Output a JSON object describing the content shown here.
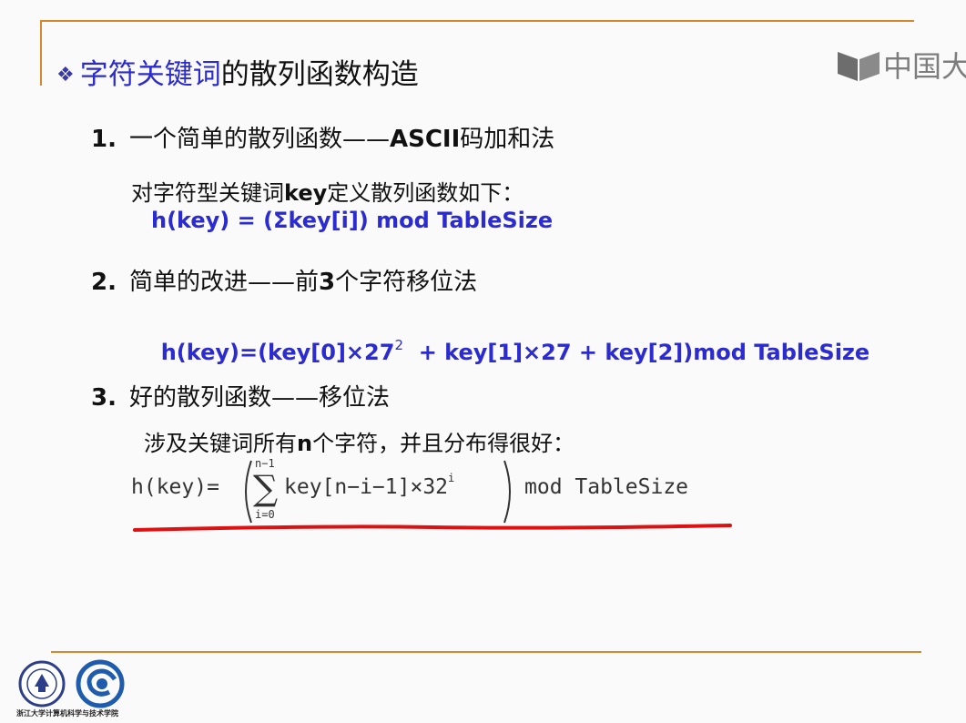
{
  "slide": {
    "title_prefix": "❖",
    "title_keyword": "字符关键词",
    "title_rest": "的散列函数构造",
    "watermark": "中国大"
  },
  "section1": {
    "number": "1.",
    "heading_cn": "一个简单的散列函数——",
    "heading_bold": "ASCII",
    "heading_tail": "码加和法",
    "desc_a": "对字符型关键词",
    "desc_key": "key",
    "desc_b": "定义散列函数如下：",
    "formula": "h(key) = (Σkey[i]) mod TableSize"
  },
  "section2": {
    "number": "2.",
    "heading_a": "简单的改进——前",
    "heading_bold": "3",
    "heading_b": "个字符移位法",
    "formula_a": "h(key)=(key[0]×27",
    "formula_sup": "2",
    "formula_b": "  + key[1]×27 + key[2])mod TableSize"
  },
  "section3": {
    "number": "3.",
    "heading": "好的散列函数——移位法",
    "desc_a": "涉及关键词所有",
    "desc_n": "n",
    "desc_b": "个字符，并且分布得很好：",
    "formula_lhs": "h(key)=",
    "sum_top": "n−1",
    "sum_bottom": "i=0",
    "formula_body": "key[n−i−1]×32",
    "formula_sup": "i",
    "formula_mod": "mod  TableSize"
  },
  "footer": {
    "caption": "浙江大学计算机科学与技术学院"
  },
  "colors": {
    "accent_line": "#d28a2c",
    "keyword_blue": "#2b2bd0",
    "underline_red": "#dd1111"
  }
}
